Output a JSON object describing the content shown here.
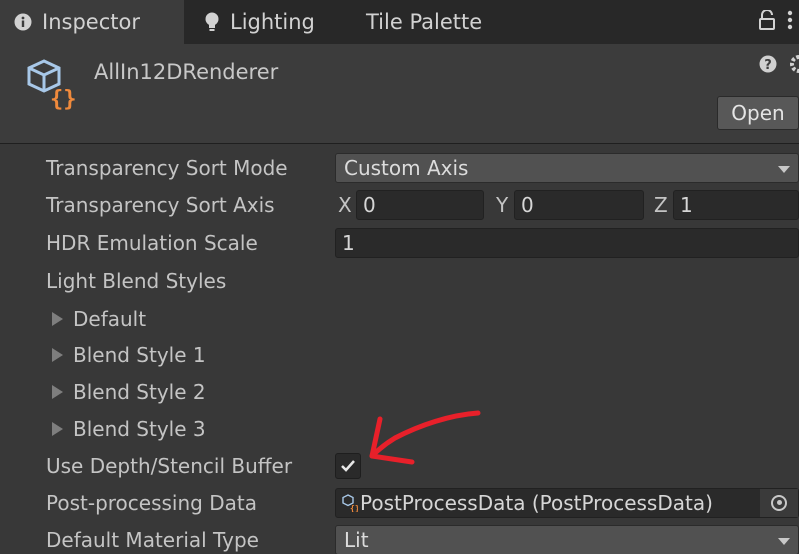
{
  "tabs": [
    {
      "label": "Inspector",
      "icon": "info-icon"
    },
    {
      "label": "Lighting",
      "icon": "lightbulb-icon"
    },
    {
      "label": "Tile Palette",
      "icon": ""
    }
  ],
  "header": {
    "asset_name": "AllIn12DRenderer",
    "asset_icon": "scriptable-object-icon",
    "open_label": "Open"
  },
  "props": {
    "sort_mode": {
      "label": "Transparency Sort Mode",
      "value": "Custom Axis"
    },
    "sort_axis": {
      "label": "Transparency Sort Axis",
      "x_label": "X",
      "x": "0",
      "y_label": "Y",
      "y": "0",
      "z_label": "Z",
      "z": "1"
    },
    "hdr_scale": {
      "label": "HDR Emulation Scale",
      "value": "1"
    },
    "light_blend_styles": {
      "label": "Light Blend Styles"
    },
    "blend_styles": [
      "Default",
      "Blend Style 1",
      "Blend Style 2",
      "Blend Style 3"
    ],
    "depth_stencil": {
      "label": "Use Depth/Stencil Buffer",
      "checked": true
    },
    "post_processing": {
      "label": "Post-processing Data",
      "value": "PostProcessData (PostProcessData)"
    },
    "material_type": {
      "label": "Default Material Type",
      "value": "Lit"
    }
  },
  "annotation": {
    "color": "#e8202a",
    "icon": "red-arrow-annotation"
  }
}
